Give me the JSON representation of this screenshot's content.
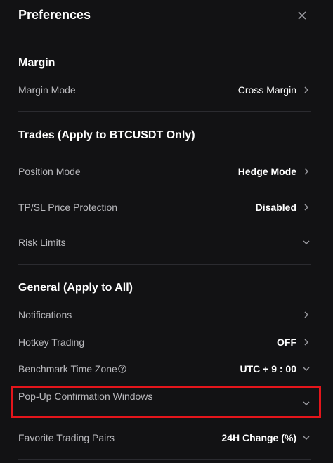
{
  "header": {
    "title": "Preferences"
  },
  "sections": {
    "margin": {
      "title": "Margin",
      "margin_mode": {
        "label": "Margin Mode",
        "value": "Cross Margin"
      }
    },
    "trades": {
      "title": "Trades (Apply to BTCUSDT Only)",
      "position_mode": {
        "label": "Position Mode",
        "value": "Hedge Mode"
      },
      "tpsl": {
        "label": "TP/SL Price Protection",
        "value": "Disabled"
      },
      "risk_limits": {
        "label": "Risk Limits"
      }
    },
    "general": {
      "title": "General (Apply to All)",
      "notifications": {
        "label": "Notifications"
      },
      "hotkey": {
        "label": "Hotkey Trading",
        "value": "OFF"
      },
      "benchmark": {
        "label": "Benchmark Time Zone",
        "value": "UTC + 9 : 00"
      },
      "popup": {
        "label": "Pop-Up Confirmation Windows"
      },
      "favorite": {
        "label": "Favorite Trading Pairs",
        "value": "24H Change (%)"
      }
    }
  },
  "colors": {
    "background": "#121214",
    "highlight": "#e4151b",
    "label": "#b8b8bc",
    "divider": "#2b2b30"
  }
}
